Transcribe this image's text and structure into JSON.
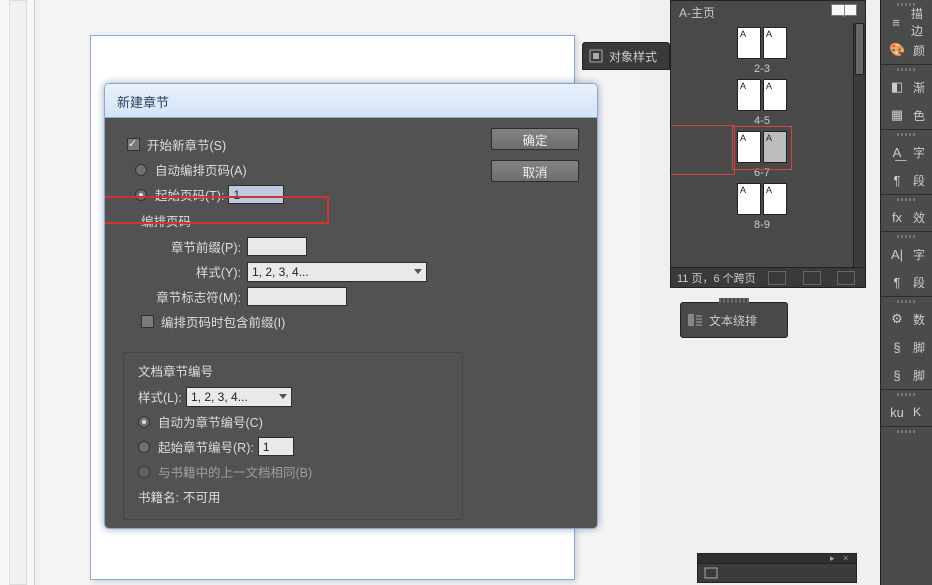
{
  "dialog": {
    "title": "新建章节",
    "ok": "确定",
    "cancel": "取消",
    "start_new_section": "开始新章节(S)",
    "auto_page_num": "自动编排页码(A)",
    "start_page_label": "起始页码(T):",
    "start_page_value": "1",
    "page_numbering_header": "编排页码",
    "prefix_label": "章节前缀(P):",
    "prefix_value": "",
    "style_label": "样式(Y):",
    "style_value": "1, 2, 3, 4...",
    "marker_label": "章节标志符(M):",
    "marker_value": "",
    "include_prefix": "编排页码时包含前缀(I)",
    "doc_section_header": "文档章节编号",
    "doc_style_label": "样式(L):",
    "doc_style_value": "1, 2, 3, 4...",
    "auto_section_num": "自动为章节编号(C)",
    "start_section_label": "起始章节编号(R):",
    "start_section_value": "1",
    "same_as_book": "与书籍中的上一文档相同(B)",
    "book_name_label": "书籍名:",
    "book_name_value": "不可用"
  },
  "object_styles_tab": "对象样式",
  "pages_panel": {
    "master": "A-主页",
    "spreads": [
      "2-3",
      "4-5",
      "6-7",
      "8-9"
    ],
    "status": "11 页，6 个跨页"
  },
  "text_wrap": "文本绕排",
  "right_rail": {
    "items": [
      {
        "icon": "≡",
        "label": "描边",
        "name": "menu-icon"
      },
      {
        "icon": "🎨",
        "label": "颜",
        "name": "palette-icon"
      },
      {
        "icon": "◧",
        "label": "渐",
        "name": "gradient-icon"
      },
      {
        "icon": "▦",
        "label": "色",
        "name": "swatches-icon"
      },
      {
        "icon": "A͟",
        "label": "字",
        "name": "char-styles-icon"
      },
      {
        "icon": "¶",
        "label": "段",
        "name": "para-styles-icon"
      },
      {
        "icon": "fx",
        "label": "效",
        "name": "effects-icon"
      },
      {
        "icon": "A|",
        "label": "字",
        "name": "character-icon"
      },
      {
        "icon": "¶",
        "label": "段",
        "name": "paragraph-icon"
      },
      {
        "icon": "⚙",
        "label": "数",
        "name": "data-merge-icon"
      },
      {
        "icon": "§",
        "label": "脚",
        "name": "script-icon"
      },
      {
        "icon": "§",
        "label": "脚",
        "name": "script-label-icon"
      },
      {
        "icon": "ku",
        "label": "K",
        "name": "kuler-icon"
      }
    ]
  }
}
